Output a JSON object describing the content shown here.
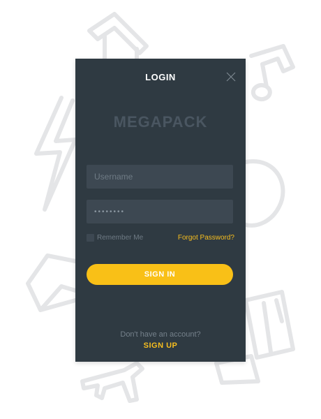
{
  "modal": {
    "title": "LOGIN",
    "brand": "MEGAPACK",
    "close_icon": "close-icon"
  },
  "form": {
    "username_placeholder": "Username",
    "password_placeholder": "••••••••",
    "remember_label": "Remember Me",
    "remember_checked": false,
    "forgot_label": "Forgot Password?",
    "signin_label": "SIGN IN"
  },
  "footer": {
    "prompt": "Don't have an account?",
    "signup_label": "SIGN UP"
  },
  "colors": {
    "panel": "#2f3a42",
    "field": "#3d4852",
    "accent": "#f9c017",
    "muted_text": "#6f7b85",
    "brand_text": "#4a5661",
    "background_illustration": "#e4e5e7"
  }
}
